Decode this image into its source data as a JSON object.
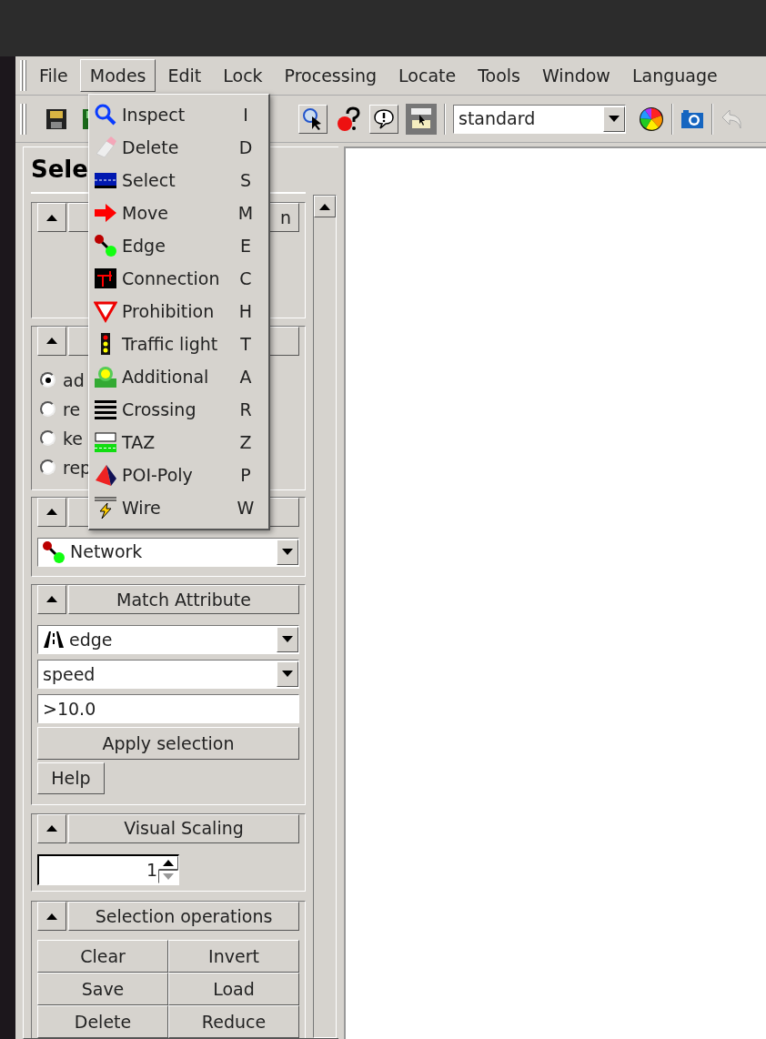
{
  "menu_bar": [
    {
      "label": "File",
      "open": false
    },
    {
      "label": "Modes",
      "open": true
    },
    {
      "label": "Edit",
      "open": false
    },
    {
      "label": "Lock",
      "open": false
    },
    {
      "label": "Processing",
      "open": false
    },
    {
      "label": "Locate",
      "open": false
    },
    {
      "label": "Tools",
      "open": false
    },
    {
      "label": "Window",
      "open": false
    },
    {
      "label": "Language",
      "open": false
    }
  ],
  "toolbar": {
    "view_scheme": "standard"
  },
  "modes_menu": [
    {
      "label": "Inspect",
      "shortcut": "I",
      "kind": "inspect"
    },
    {
      "label": "Delete",
      "shortcut": "D",
      "kind": "delete"
    },
    {
      "label": "Select",
      "shortcut": "S",
      "kind": "select"
    },
    {
      "label": "Move",
      "shortcut": "M",
      "kind": "move"
    },
    {
      "label": "Edge",
      "shortcut": "E",
      "kind": "edge"
    },
    {
      "label": "Connection",
      "shortcut": "C",
      "kind": "connection"
    },
    {
      "label": "Prohibition",
      "shortcut": "H",
      "kind": "prohibition"
    },
    {
      "label": "Traffic light",
      "shortcut": "T",
      "kind": "traffic_light"
    },
    {
      "label": "Additional",
      "shortcut": "A",
      "kind": "additional"
    },
    {
      "label": "Crossing",
      "shortcut": "R",
      "kind": "crossing"
    },
    {
      "label": "TAZ",
      "shortcut": "Z",
      "kind": "taz"
    },
    {
      "label": "POI-Poly",
      "shortcut": "P",
      "kind": "poi_poly"
    },
    {
      "label": "Wire",
      "shortcut": "W",
      "kind": "wire"
    }
  ],
  "selection_panel": {
    "title": "Sele",
    "first_group_header": "n",
    "radios": [
      {
        "label": "ad",
        "selected": true
      },
      {
        "label": "re",
        "selected": false
      },
      {
        "label": "ke",
        "selected": false
      },
      {
        "label": "rep",
        "selected": false
      }
    ],
    "element_set": "Network",
    "match_attribute": {
      "title": "Match Attribute",
      "element": "edge",
      "attribute": "speed",
      "value": ">10.0",
      "apply": "Apply selection",
      "help": "Help"
    },
    "visual_scaling": {
      "title": "Visual Scaling",
      "value": "1"
    },
    "operations": {
      "title": "Selection operations",
      "buttons": [
        "Clear",
        "Invert",
        "Save",
        "Load",
        "Delete",
        "Reduce"
      ]
    }
  }
}
